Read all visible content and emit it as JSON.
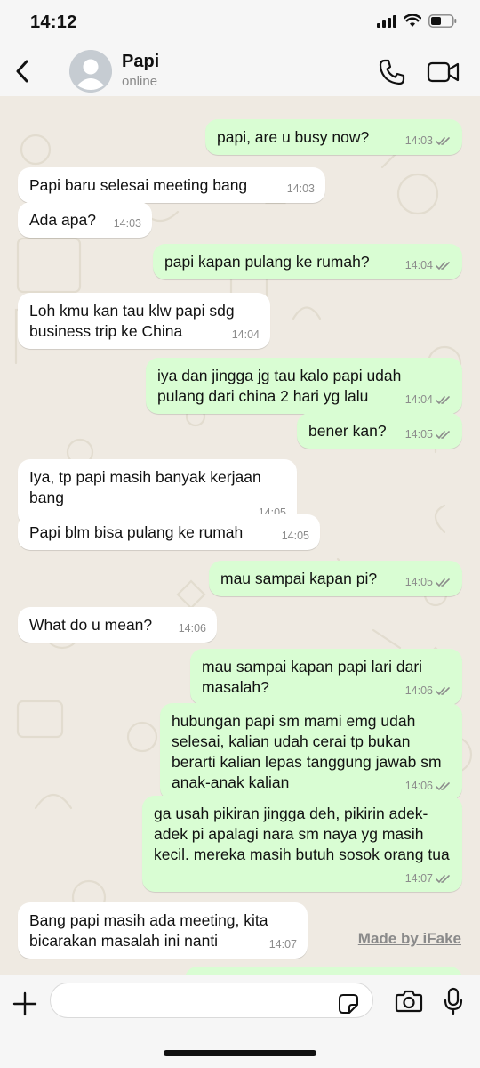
{
  "status_bar": {
    "time": "14:12"
  },
  "header": {
    "contact_name": "Papi",
    "contact_status": "online"
  },
  "messages": [
    {
      "dir": "out",
      "text": "papi, are u busy now?",
      "time": "14:03",
      "read": true
    },
    {
      "dir": "in",
      "text": "Papi baru selesai meeting bang",
      "time": "14:03"
    },
    {
      "dir": "in",
      "text": "Ada apa?",
      "time": "14:03"
    },
    {
      "dir": "out",
      "text": "papi kapan pulang ke rumah?",
      "time": "14:04",
      "read": true
    },
    {
      "dir": "in",
      "text": "Loh kmu kan tau klw papi sdg business trip ke China",
      "time": "14:04"
    },
    {
      "dir": "out",
      "text": "iya dan jingga jg tau kalo papi udah pulang dari china 2 hari yg lalu",
      "time": "14:04",
      "read": true
    },
    {
      "dir": "out",
      "text": "bener kan?",
      "time": "14:05",
      "read": true
    },
    {
      "dir": "in",
      "text": "Iya, tp papi masih banyak kerjaan bang",
      "time": "14:05"
    },
    {
      "dir": "in",
      "text": "Papi blm bisa pulang ke rumah",
      "time": "14:05"
    },
    {
      "dir": "out",
      "text": "mau sampai kapan pi?",
      "time": "14:05",
      "read": true
    },
    {
      "dir": "in",
      "text": "What do u mean?",
      "time": "14:06"
    },
    {
      "dir": "out",
      "text": "mau sampai kapan papi lari dari masalah?",
      "time": "14:06",
      "read": true
    },
    {
      "dir": "out",
      "text": "hubungan papi sm mami emg udah selesai, kalian udah cerai tp bukan berarti kalian lepas tanggung jawab sm anak-anak kalian",
      "time": "14:06",
      "read": true
    },
    {
      "dir": "out",
      "text": "ga usah pikiran jingga deh, pikirin adek-adek pi apalagi nara sm naya yg masih kecil. mereka masih butuh sosok orang tua",
      "time": "14:07",
      "read": true
    },
    {
      "dir": "in",
      "text": "Bang papi masih ada meeting, kita bicarakan masalah ini nanti",
      "time": "14:07"
    }
  ],
  "watermark": "Made by iFake",
  "composer": {
    "value": "",
    "placeholder": ""
  },
  "colors": {
    "incoming": "#ffffff",
    "outgoing": "#d9fdd3",
    "chat_bg": "#efeae2",
    "read_ticks": "#8c8c8c"
  },
  "icons": [
    "back-icon",
    "avatar-icon",
    "phone-icon",
    "video-icon",
    "plus-icon",
    "sticker-icon",
    "camera-icon",
    "mic-icon"
  ]
}
